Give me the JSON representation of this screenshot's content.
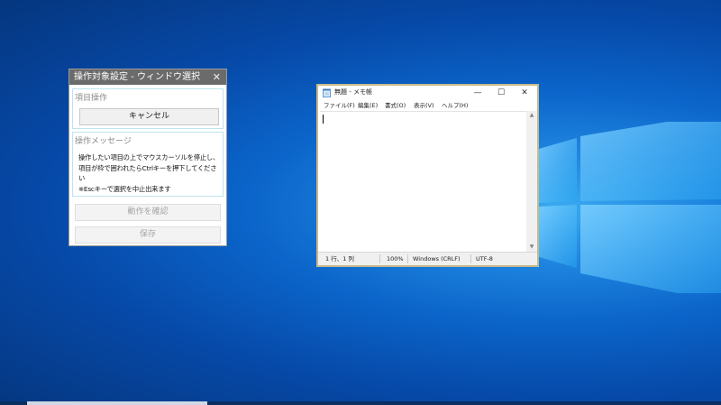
{
  "dialog": {
    "title": "操作対象設定 - ウィンドウ選択",
    "close_glyph": "✕",
    "operation_group": {
      "label": "項目操作",
      "cancel_label": "キャンセル"
    },
    "message_group": {
      "label": "操作メッセージ",
      "line1": "操作したい項目の上でマウスカーソルを停止し、",
      "line2": "項目が枠で囲われたらCtrlキーを押下してください",
      "line3": "※Escキーで選択を中止出来ます"
    },
    "confirm_label": "動作を確認",
    "save_label": "保存"
  },
  "notepad": {
    "title": "無題 - メモ帳",
    "controls": {
      "minimize": "—",
      "maximize": "☐",
      "close": "✕"
    },
    "menu": {
      "file": "ファイル(F)",
      "edit": "編集(E)",
      "format": "書式(O)",
      "view": "表示(V)",
      "help": "ヘルプ(H)"
    },
    "scroll": {
      "up": "▲",
      "down": "▼"
    },
    "status": {
      "position": "1 行、1 列",
      "zoom": "100%",
      "line_ending": "Windows (CRLF)",
      "encoding": "UTF-8"
    }
  },
  "colors": {
    "desktop_blue": "#0b64c9",
    "dialog_titlebar": "#6b6b6b",
    "group_border": "#bfe3ee",
    "notepad_border": "#c8b98a"
  }
}
